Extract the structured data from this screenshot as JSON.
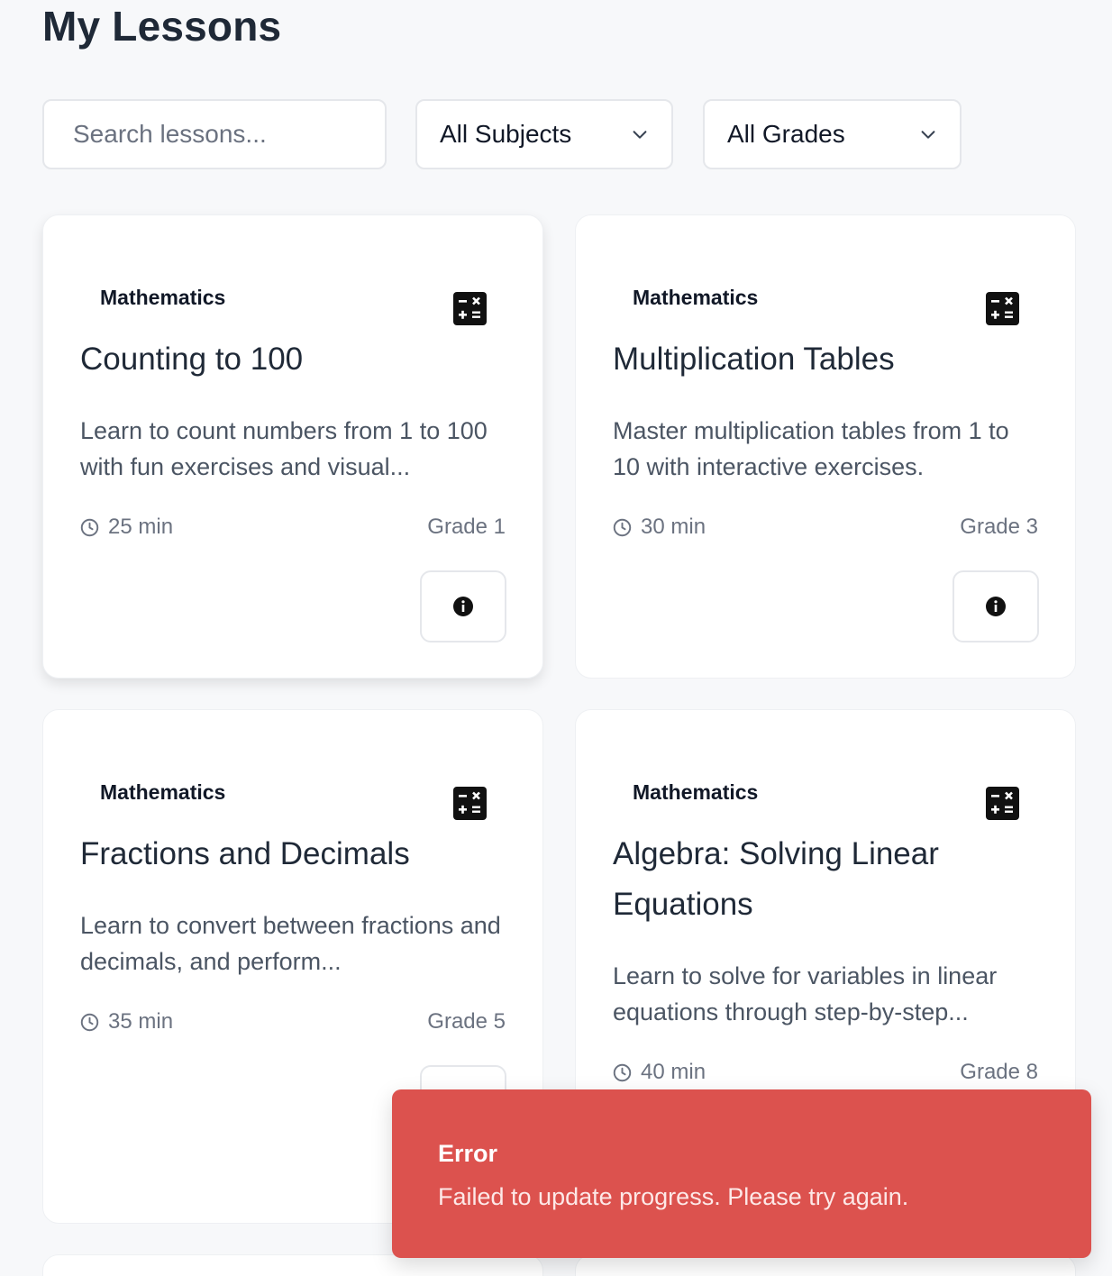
{
  "page": {
    "title": "My Lessons"
  },
  "filters": {
    "search_placeholder": "Search lessons...",
    "subject_selected": "All Subjects",
    "grade_selected": "All Grades"
  },
  "lessons": [
    {
      "subject": "Mathematics",
      "subject_icon": "calculator-icon",
      "title": "Counting to 100",
      "description": "Learn to count numbers from 1 to 100 with fun exercises and visual...",
      "duration": "25 min",
      "grade": "Grade 1"
    },
    {
      "subject": "Mathematics",
      "subject_icon": "calculator-icon",
      "title": "Multiplication Tables",
      "description": "Master multiplication tables from 1 to 10 with interactive exercises.",
      "duration": "30 min",
      "grade": "Grade 3"
    },
    {
      "subject": "Mathematics",
      "subject_icon": "calculator-icon",
      "title": "Fractions and Decimals",
      "description": "Learn to convert between fractions and decimals, and perform...",
      "duration": "35 min",
      "grade": "Grade 5"
    },
    {
      "subject": "Mathematics",
      "subject_icon": "calculator-icon",
      "title": "Algebra: Solving Linear Equations",
      "description": "Learn to solve for variables in linear equations through step-by-step...",
      "duration": "40 min",
      "grade": "Grade 8"
    }
  ],
  "toast": {
    "title": "Error",
    "message": "Failed to update progress. Please try again.",
    "color": "#dc524e"
  }
}
